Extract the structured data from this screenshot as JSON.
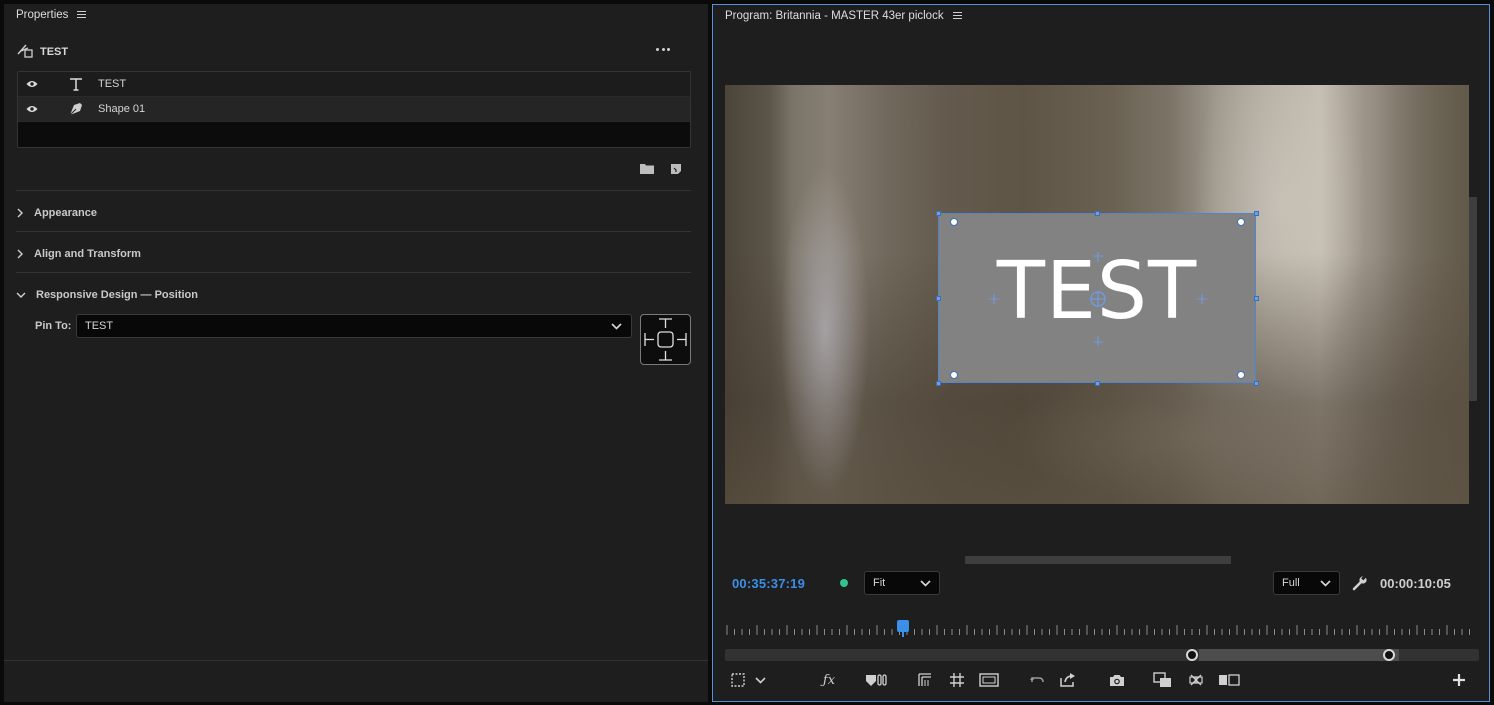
{
  "properties_panel": {
    "title": "Properties",
    "graphic_name": "TEST",
    "layers": [
      {
        "name": "TEST",
        "type": "text-layer-icon"
      },
      {
        "name": "Shape 01",
        "type": "pen-icon"
      }
    ],
    "sections": [
      {
        "label": "Appearance",
        "expanded": false
      },
      {
        "label": "Align and Transform",
        "expanded": false
      },
      {
        "label": "Responsive Design — Position",
        "expanded": true
      }
    ],
    "pin_to": {
      "label": "Pin To:",
      "value": "TEST"
    }
  },
  "program_monitor": {
    "title": "Program: Britannia - MASTER 43er piclock",
    "overlay_text": "TEST",
    "timecode_current": "00:35:37:19",
    "zoom_select": "Fit",
    "resolution_select": "Full",
    "timecode_duration": "00:00:10:05"
  },
  "colors": {
    "accent_blue": "#3b8fe8",
    "status_green": "#31c48d",
    "panel_bg": "#1e1e1e",
    "selection_border": "#4f86d4"
  },
  "toolbar_icons": [
    "selection-zoom-icon",
    "dropdown-chevron-icon",
    "fx-icon",
    "insert-marker-icon",
    "safe-margins-icon",
    "grid-icon",
    "frame-icon",
    "undo-icon",
    "export-icon",
    "camera-icon",
    "multicam-icon",
    "vr-icon",
    "comparison-icon",
    "add-icon"
  ]
}
